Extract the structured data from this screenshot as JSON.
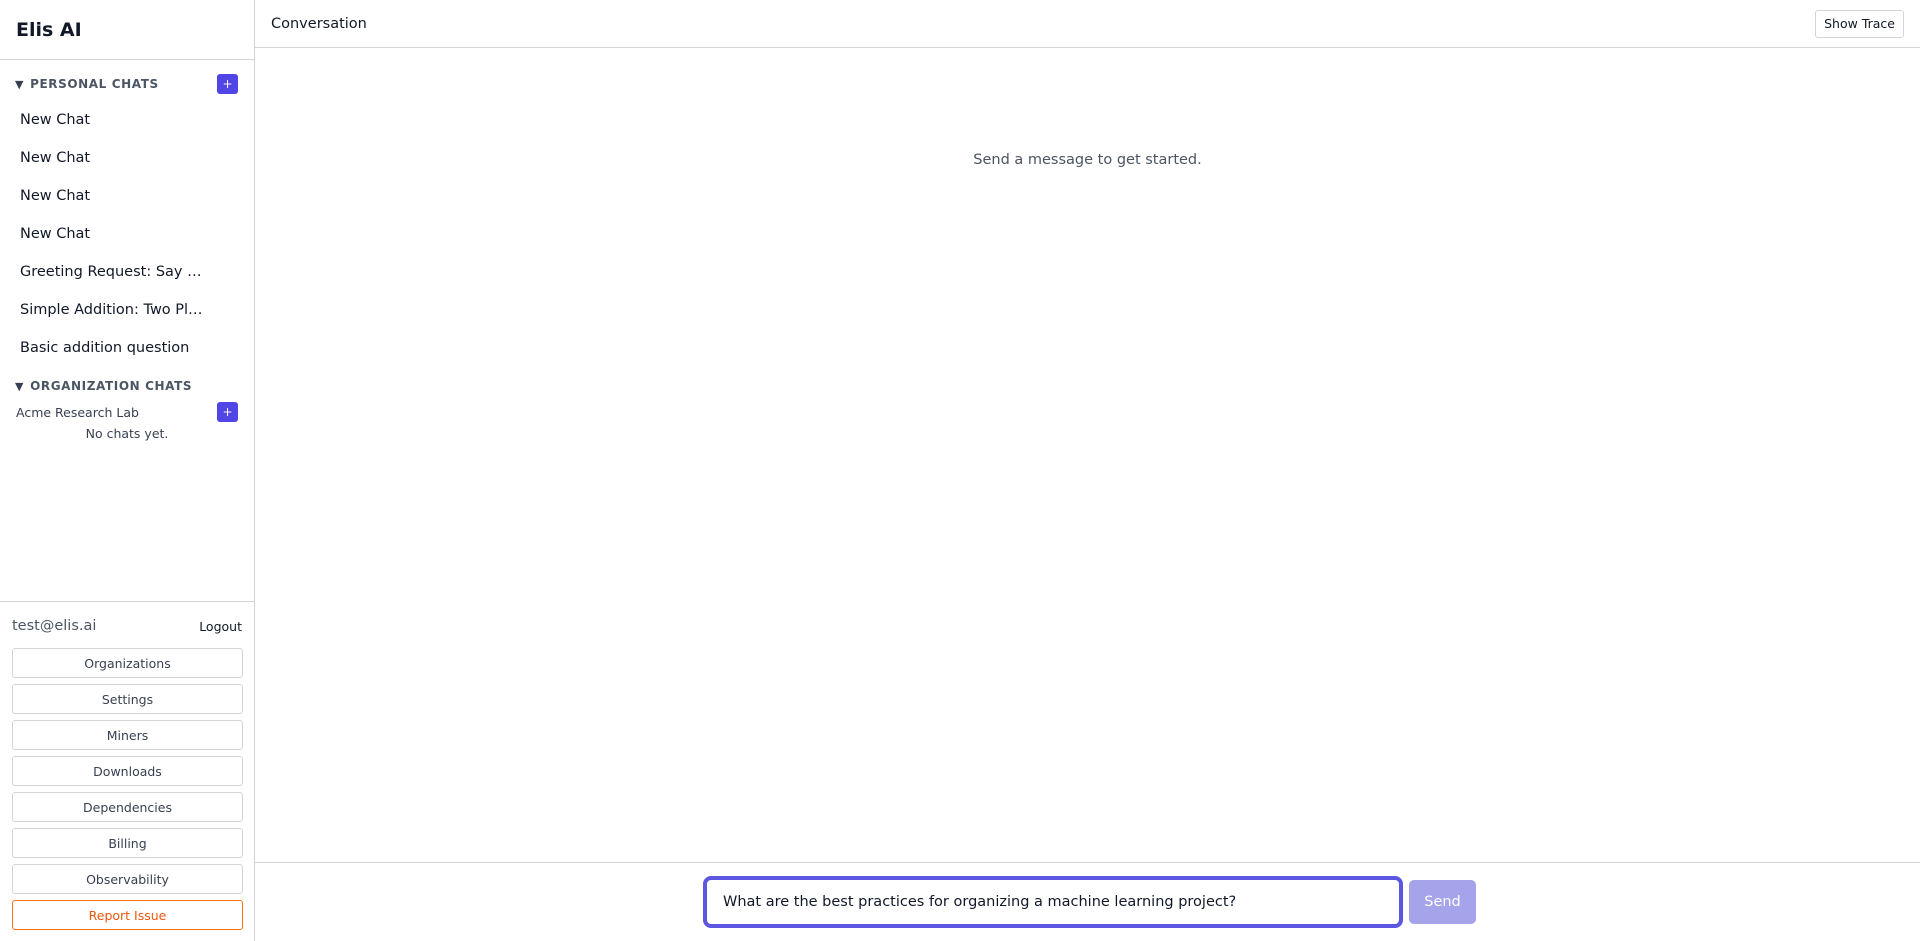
{
  "app": {
    "brand": "Elis AI"
  },
  "sidebar": {
    "personal": {
      "title": "PERSONAL CHATS",
      "add_label": "+",
      "chats": [
        "New Chat",
        "New Chat",
        "New Chat",
        "New Chat",
        "Greeting Request: Say …",
        "Simple Addition: Two Pl…",
        "Basic addition question"
      ]
    },
    "organization": {
      "title": "ORGANIZATION CHATS",
      "org_name": "Acme Research Lab",
      "add_label": "+",
      "empty": "No chats yet."
    },
    "footer": {
      "email": "test@elis.ai",
      "logout": "Logout",
      "buttons": [
        "Organizations",
        "Settings",
        "Miners",
        "Downloads",
        "Dependencies",
        "Billing",
        "Observability"
      ],
      "report": "Report Issue"
    }
  },
  "main": {
    "title": "Conversation",
    "trace_button": "Show Trace",
    "empty_state": "Send a message to get started.",
    "composer": {
      "value": "What are the best practices for organizing a machine learning project?",
      "send": "Send"
    }
  },
  "colors": {
    "accent": "#4f46e5",
    "send_disabled": "#a5a3ea",
    "report": "#ea580c"
  }
}
